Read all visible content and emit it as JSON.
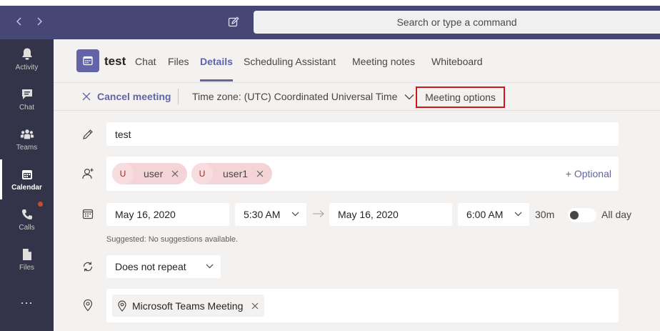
{
  "search": {
    "placeholder": "Search or type a command"
  },
  "rail": {
    "items": [
      {
        "label": "Activity",
        "icon": "bell-icon"
      },
      {
        "label": "Chat",
        "icon": "chat-icon"
      },
      {
        "label": "Teams",
        "icon": "teams-icon"
      },
      {
        "label": "Calendar",
        "icon": "calendar-icon",
        "active": true
      },
      {
        "label": "Calls",
        "icon": "phone-icon",
        "badge": true
      },
      {
        "label": "Files",
        "icon": "file-icon"
      }
    ],
    "more": "..."
  },
  "header": {
    "title": "test",
    "tabs": [
      {
        "label": "Chat"
      },
      {
        "label": "Files"
      },
      {
        "label": "Details",
        "active": true
      },
      {
        "label": "Scheduling Assistant"
      },
      {
        "label": "Meeting notes"
      },
      {
        "label": "Whiteboard"
      }
    ]
  },
  "toolbar": {
    "cancel_label": "Cancel meeting",
    "timezone_label": "Time zone: (UTC) Coordinated Universal Time",
    "meeting_options_label": "Meeting options"
  },
  "form": {
    "title_value": "test",
    "attendees": [
      {
        "initial": "U",
        "name": "user"
      },
      {
        "initial": "U",
        "name": "user1"
      }
    ],
    "optional_label": "+ Optional",
    "start_date": "May 16, 2020",
    "start_time": "5:30 AM",
    "end_date": "May 16, 2020",
    "end_time": "6:00 AM",
    "duration": "30m",
    "all_day_label": "All day",
    "all_day_on": false,
    "suggested": "Suggested: No suggestions available.",
    "repeat_value": "Does not repeat",
    "location_value": "Microsoft Teams Meeting"
  },
  "colors": {
    "brand": "#6264a7",
    "topbar": "#464775",
    "rail": "#33344a",
    "highlight": "#d0151d"
  }
}
